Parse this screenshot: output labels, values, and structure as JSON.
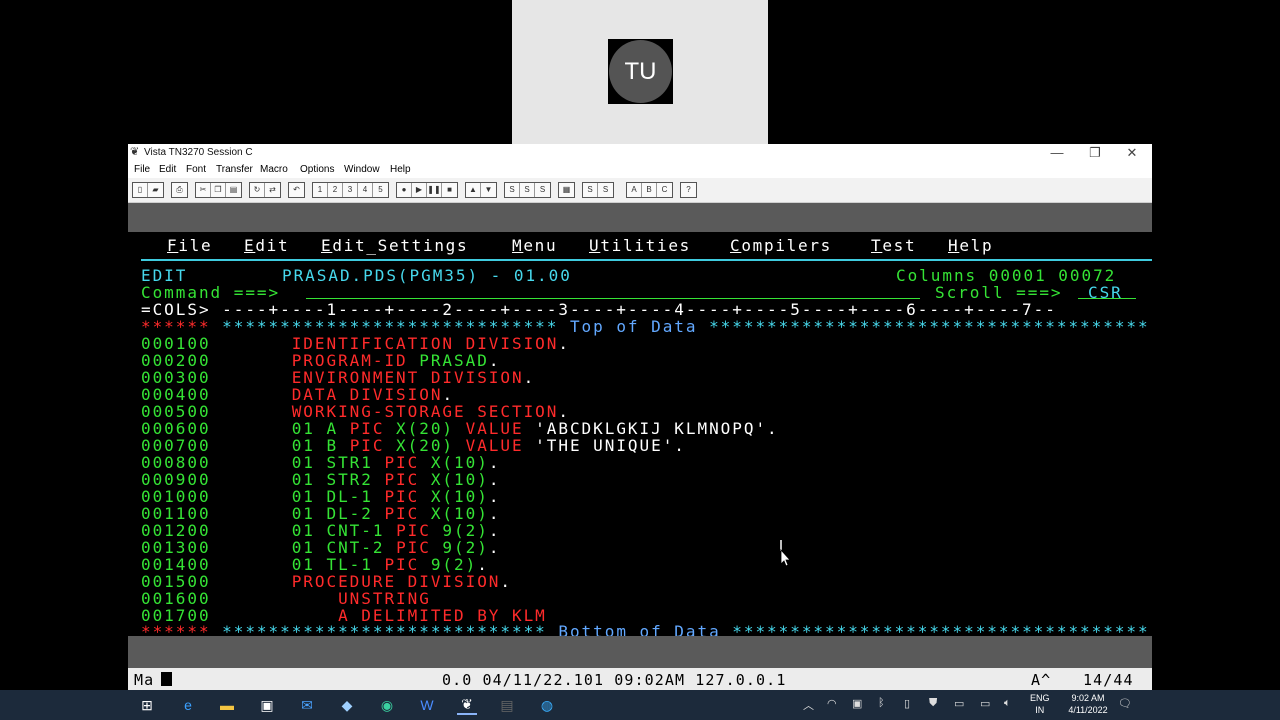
{
  "participant": {
    "initials": "TU"
  },
  "window": {
    "title": "Vista TN3270 Session C",
    "controls": {
      "minimize": "—",
      "restore": "❐",
      "close": "✕"
    },
    "menu": [
      "File",
      "Edit",
      "Font",
      "Transfer",
      "Macro",
      "Options",
      "Window",
      "Help"
    ],
    "toolbar_groups": [
      [
        "new",
        "open"
      ],
      [
        "print"
      ],
      [
        "cut",
        "copy",
        "paste"
      ],
      [
        "reconnect",
        "disconnect"
      ],
      [
        "undo"
      ],
      [
        "1",
        "2",
        "3",
        "4",
        "5"
      ],
      [
        "record",
        "play",
        "pause",
        "stop"
      ],
      [
        "up",
        "down"
      ],
      [
        "settings-a",
        "settings-b",
        "settings-c"
      ],
      [
        "keypad"
      ],
      [
        "screen-a",
        "screen-b"
      ],
      [
        "A",
        "B",
        "C"
      ],
      [
        "?"
      ]
    ]
  },
  "terminal": {
    "action_bar": [
      {
        "hot": "F",
        "rest": "ile"
      },
      {
        "hot": "E",
        "rest": "dit"
      },
      {
        "hot": "E",
        "rest": "dit_Settings"
      },
      {
        "hot": "M",
        "rest": "enu"
      },
      {
        "hot": "U",
        "rest": "tilities"
      },
      {
        "hot": "C",
        "rest": "ompilers"
      },
      {
        "hot": "T",
        "rest": "est"
      },
      {
        "hot": "H",
        "rest": "elp"
      }
    ],
    "header": {
      "mode": "EDIT",
      "dataset": "PRASAD.PDS(PGM35) - 01.00",
      "columns": "Columns 00001 00072",
      "command_label": "Command ===>",
      "scroll_label": "Scroll ===>",
      "scroll_value": "CSR",
      "cols_label": "=COLS>",
      "ruler": " ----+----1----+----2----+----3----+----4----+----5----+----6----+----7--"
    },
    "top_marker": {
      "prefix": "******",
      "stars_left": " ***************************** ",
      "text": "Top of Data",
      "stars_right": " **************************************"
    },
    "bottom_marker": {
      "prefix": "******",
      "stars_left": " **************************** ",
      "text": "Bottom of Data",
      "stars_right": " ************************************"
    },
    "lines": [
      {
        "num": "000100",
        "segs": [
          [
            "r",
            "IDENTIFICATION DIVISION"
          ],
          [
            "w",
            "."
          ]
        ]
      },
      {
        "num": "000200",
        "segs": [
          [
            "r",
            "PROGRAM-ID"
          ],
          [
            "w",
            " "
          ],
          [
            "g",
            "PRASAD"
          ],
          [
            "w",
            "."
          ]
        ]
      },
      {
        "num": "000300",
        "segs": [
          [
            "r",
            "ENVIRONMENT DIVISION"
          ],
          [
            "w",
            "."
          ]
        ]
      },
      {
        "num": "000400",
        "segs": [
          [
            "r",
            "DATA DIVISION"
          ],
          [
            "w",
            "."
          ]
        ]
      },
      {
        "num": "000500",
        "segs": [
          [
            "r",
            "WORKING-STORAGE SECTION"
          ],
          [
            "w",
            "."
          ]
        ]
      },
      {
        "num": "000600",
        "segs": [
          [
            "g",
            "01 A "
          ],
          [
            "r",
            "PIC"
          ],
          [
            "g",
            " X(20) "
          ],
          [
            "r",
            "VALUE"
          ],
          [
            "w",
            " 'ABCDKLGKIJ KLMNOPQ'."
          ]
        ]
      },
      {
        "num": "000700",
        "segs": [
          [
            "g",
            "01 B "
          ],
          [
            "r",
            "PIC"
          ],
          [
            "g",
            " X(20) "
          ],
          [
            "r",
            "VALUE"
          ],
          [
            "w",
            " 'THE UNIQUE'."
          ]
        ]
      },
      {
        "num": "000800",
        "segs": [
          [
            "g",
            "01 STR1 "
          ],
          [
            "r",
            "PIC"
          ],
          [
            "g",
            " X(10)"
          ],
          [
            "w",
            "."
          ]
        ]
      },
      {
        "num": "000900",
        "segs": [
          [
            "g",
            "01 STR2 "
          ],
          [
            "r",
            "PIC"
          ],
          [
            "g",
            " X(10)"
          ],
          [
            "w",
            "."
          ]
        ]
      },
      {
        "num": "001000",
        "segs": [
          [
            "g",
            "01 DL-1 "
          ],
          [
            "r",
            "PIC"
          ],
          [
            "g",
            " X(10)"
          ],
          [
            "w",
            "."
          ]
        ]
      },
      {
        "num": "001100",
        "segs": [
          [
            "g",
            "01 DL-2 "
          ],
          [
            "r",
            "PIC"
          ],
          [
            "g",
            " X(10)"
          ],
          [
            "w",
            "."
          ]
        ]
      },
      {
        "num": "001200",
        "segs": [
          [
            "g",
            "01 CNT-1 "
          ],
          [
            "r",
            "PIC"
          ],
          [
            "g",
            " 9(2)"
          ],
          [
            "w",
            "."
          ]
        ]
      },
      {
        "num": "001300",
        "segs": [
          [
            "g",
            "01 CNT-2 "
          ],
          [
            "r",
            "PIC"
          ],
          [
            "g",
            " 9(2)"
          ],
          [
            "w",
            "."
          ]
        ]
      },
      {
        "num": "001400",
        "segs": [
          [
            "g",
            "01 TL-1 "
          ],
          [
            "r",
            "PIC"
          ],
          [
            "g",
            " 9(2)"
          ],
          [
            "w",
            "."
          ]
        ]
      },
      {
        "num": "001500",
        "segs": [
          [
            "r",
            "PROCEDURE DIVISION"
          ],
          [
            "w",
            "."
          ]
        ]
      },
      {
        "num": "001600",
        "segs": [
          [
            "r",
            "    UNSTRING"
          ]
        ]
      },
      {
        "num": "001700",
        "segs": [
          [
            "r",
            "    A DELIMITED BY KLM"
          ]
        ]
      }
    ]
  },
  "status_bar": {
    "left": "Ma",
    "center": "0.0 04/11/22.101 09:02AM 127.0.0.1",
    "right_mode": "A^",
    "cursor_pos": "14/44"
  },
  "taskbar": {
    "lang_line1": "ENG",
    "lang_line2": "IN",
    "time": "9:02 AM",
    "date": "4/11/2022"
  }
}
